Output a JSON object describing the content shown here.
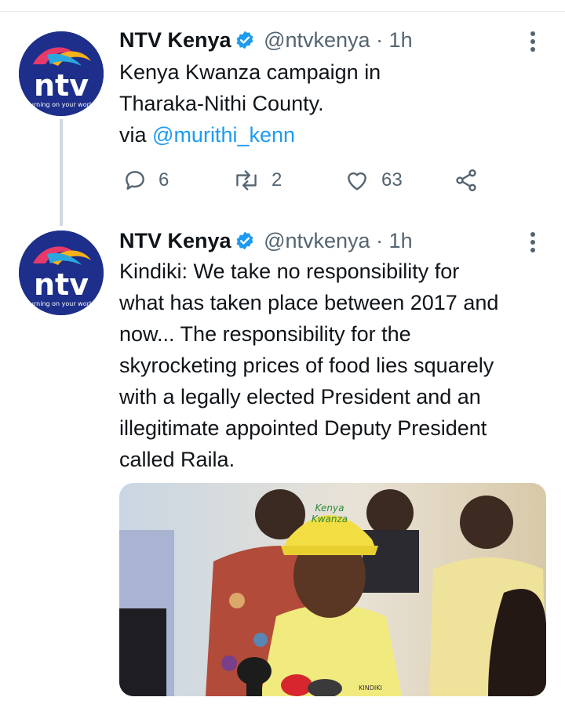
{
  "tweets": [
    {
      "author": "NTV Kenya",
      "handle": "@ntvkenya",
      "time": "· 1h",
      "text_line1": "Kenya Kwanza campaign in",
      "text_line2": "Tharaka-Nithi County.",
      "via_prefix": "via ",
      "via_link": "@murithi_kenn",
      "replies": "6",
      "retweets": "2",
      "likes": "63"
    },
    {
      "author": "NTV Kenya",
      "handle": "@ntvkenya",
      "time": "· 1h",
      "lines": [
        "Kindiki: We take no responsibility for",
        "what has taken place between 2017 and",
        "now... The responsibility for the",
        "skyrocketing prices of food lies squarely",
        "with a legally elected President and an",
        "illegitimate appointed Deputy President",
        "called Raila."
      ]
    }
  ],
  "avatar": {
    "logo_text": "ntv",
    "tagline": "turning on your world"
  },
  "photo": {
    "cap_text_line1": "Kenya",
    "cap_text_line2": "Kwanza",
    "shirt_text": "KINDIKI"
  },
  "colors": {
    "accent": "#1d9bf0",
    "secondary_text": "#536471",
    "avatar_bg": "#1d2f8a"
  },
  "icons": [
    "verified-badge-icon",
    "more-options-icon",
    "reply-icon",
    "retweet-icon",
    "like-icon",
    "share-icon"
  ]
}
